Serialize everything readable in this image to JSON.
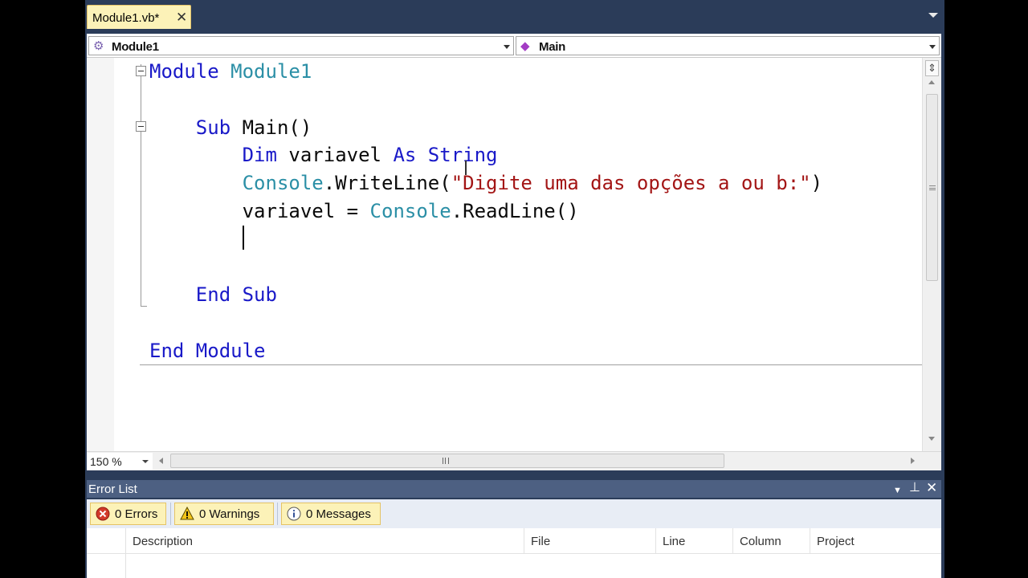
{
  "document_tab": {
    "title": "Module1.vb*"
  },
  "navigation_bar": {
    "type_combo": "Module1",
    "member_combo": "Main"
  },
  "code_lines": [
    {
      "tokens": [
        {
          "t": "Module ",
          "k": "kw"
        },
        {
          "t": "Module1",
          "k": "ty"
        }
      ]
    },
    {
      "tokens": []
    },
    {
      "tokens": [
        {
          "t": "    Sub ",
          "k": "kw"
        },
        {
          "t": "Main()",
          "k": "pl"
        }
      ]
    },
    {
      "tokens": [
        {
          "t": "        Dim ",
          "k": "kw"
        },
        {
          "t": "variavel ",
          "k": "pl"
        },
        {
          "t": "As ",
          "k": "kw"
        },
        {
          "t": "String",
          "k": "kw"
        }
      ]
    },
    {
      "tokens": [
        {
          "t": "        Console",
          "k": "ty"
        },
        {
          "t": ".WriteLine(",
          "k": "pl"
        },
        {
          "t": "\"Digite uma das opções a ou b:\"",
          "k": "str"
        },
        {
          "t": ")",
          "k": "pl"
        }
      ]
    },
    {
      "tokens": [
        {
          "t": "        variavel = ",
          "k": "pl"
        },
        {
          "t": "Console",
          "k": "ty"
        },
        {
          "t": ".ReadLine()",
          "k": "pl"
        }
      ]
    },
    {
      "tokens": []
    },
    {
      "tokens": []
    },
    {
      "tokens": [
        {
          "t": "    End Sub",
          "k": "kw"
        }
      ]
    },
    {
      "tokens": []
    },
    {
      "tokens": [
        {
          "t": "End Module",
          "k": "kw"
        }
      ]
    }
  ],
  "editor": {
    "zoom": "150 %"
  },
  "error_list": {
    "title": "Error List",
    "filters": {
      "errors": "0 Errors",
      "warnings": "0 Warnings",
      "messages": "0 Messages"
    },
    "columns": {
      "description": "Description",
      "file": "File",
      "line": "Line",
      "column": "Column",
      "project": "Project"
    }
  },
  "colors": {
    "keyword": "#1919c8",
    "type": "#2b8fa6",
    "string": "#a31515",
    "chrome": "#2b3c59",
    "tab_active": "#fcf2b8"
  }
}
